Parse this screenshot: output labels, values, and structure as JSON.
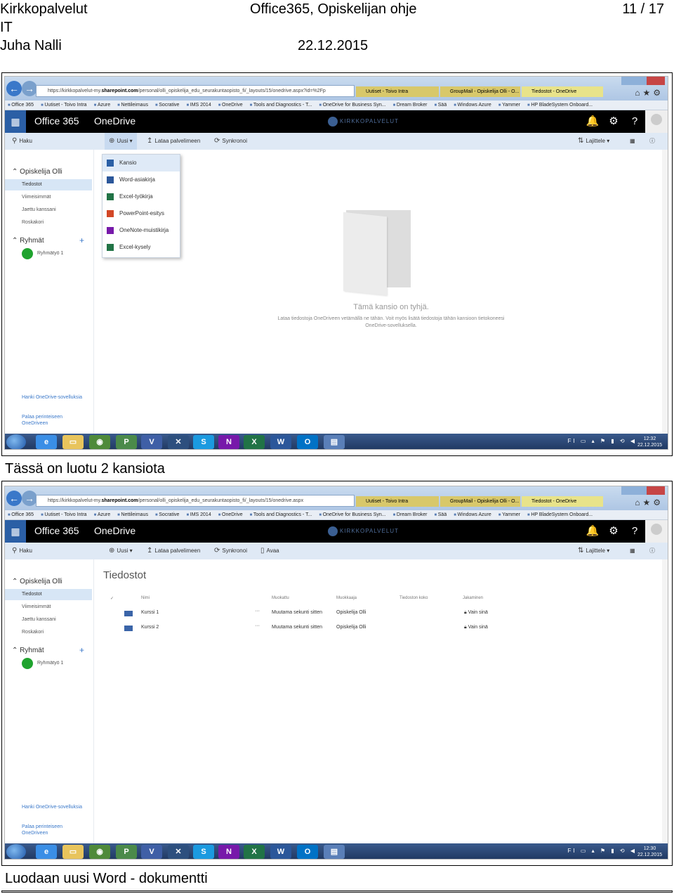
{
  "doc_header": {
    "org": "Kirkkopalvelut",
    "dept": "IT",
    "author": "Juha Nalli",
    "title": "Office365, Opiskelijan ohje",
    "date": "22.12.2015",
    "page": "11 / 17"
  },
  "captions": {
    "first": "Tässä on luotu 2 kansiota",
    "second": "Luodaan uusi Word - dokumentti"
  },
  "browser": {
    "url_prefix": "https://kirkkopalvelut-my.",
    "url_domain": "sharepoint.com",
    "url_path_1": "/personal/olli_opiskelija_edu_seurakuntaopisto_fi/_layouts/15/onedrive.aspx?id=%2Fp",
    "url_path_2": "/personal/olli_opiskelija_edu_seurakuntaopisto_fi/_layouts/15/onedrive.aspx",
    "tabs": [
      "Uutiset - Toivo Intra",
      "GroupMail - Opiskelija Olli - O...",
      "Tiedostot - OneDrive"
    ],
    "favorites": [
      "Office 365",
      "Uutiset - Toivo Intra",
      "Azure",
      "Nettileimaus",
      "Socrative",
      "IMS 2014",
      "OneDrive",
      "Tools and Diagnostics - T...",
      "OneDrive for Business Syn...",
      "Dream Broker",
      "Sää",
      "Windows Azure",
      "Yammer",
      "HP BladeSystem Onboard..."
    ]
  },
  "suite": {
    "app": "Office 365",
    "product": "OneDrive",
    "logo": "KIRKKOPALVELUT",
    "icons": [
      "bell-icon",
      "gear-icon",
      "help-icon"
    ]
  },
  "cmd": {
    "search": "Haku",
    "new": "Uusi",
    "upload": "Lataa palvelimeen",
    "sync": "Synkronoi",
    "open": "Avaa",
    "sort": "Lajittele"
  },
  "nav": {
    "user": "Opiskelija Olli",
    "files": "Tiedostot",
    "recent": "Viimeisimmät",
    "shared": "Jaettu kanssani",
    "trash": "Roskakori",
    "groups": "Ryhmät",
    "group1": "Ryhmätyö 1",
    "get_apps": "Hanki OneDrive-sovelluksia",
    "classic": "Palaa perinteiseen OneDriveen"
  },
  "new_menu": [
    "Kansio",
    "Word-asiakirja",
    "Excel-työkirja",
    "PowerPoint-esitys",
    "OneNote-muistikirja",
    "Excel-kysely"
  ],
  "empty": {
    "title": "Tämä kansio on tyhjä.",
    "text": "Lataa tiedostoja OneDriveen vetämällä ne tähän. Voit myös lisätä tiedostoja tähän kansioon tietokoneesi OneDrive-sovelluksella."
  },
  "files_view": {
    "title": "Tiedostot",
    "columns": [
      "Nimi",
      "Muokattu",
      "Muokkaaja",
      "Tiedoston koko",
      "Jakaminen"
    ],
    "rows": [
      {
        "name": "Kurssi 1",
        "modified": "Muutama sekunti sitten",
        "by": "Opiskelija Olli",
        "sharing": "Vain sinä"
      },
      {
        "name": "Kurssi 2",
        "modified": "Muutama sekunti sitten",
        "by": "Opiskelija Olli",
        "sharing": "Vain sinä"
      }
    ]
  },
  "taskbar": {
    "apps": [
      "ie-icon",
      "explorer-icon",
      "chrome-icon",
      "publisher-icon",
      "visio-icon",
      "tool-icon",
      "skype-icon",
      "onenote-icon",
      "excel-icon",
      "word-icon",
      "outlook-icon",
      "remote-icon"
    ],
    "time_1": "12:32",
    "time_2": "12:30",
    "date": "22.12.2015"
  }
}
